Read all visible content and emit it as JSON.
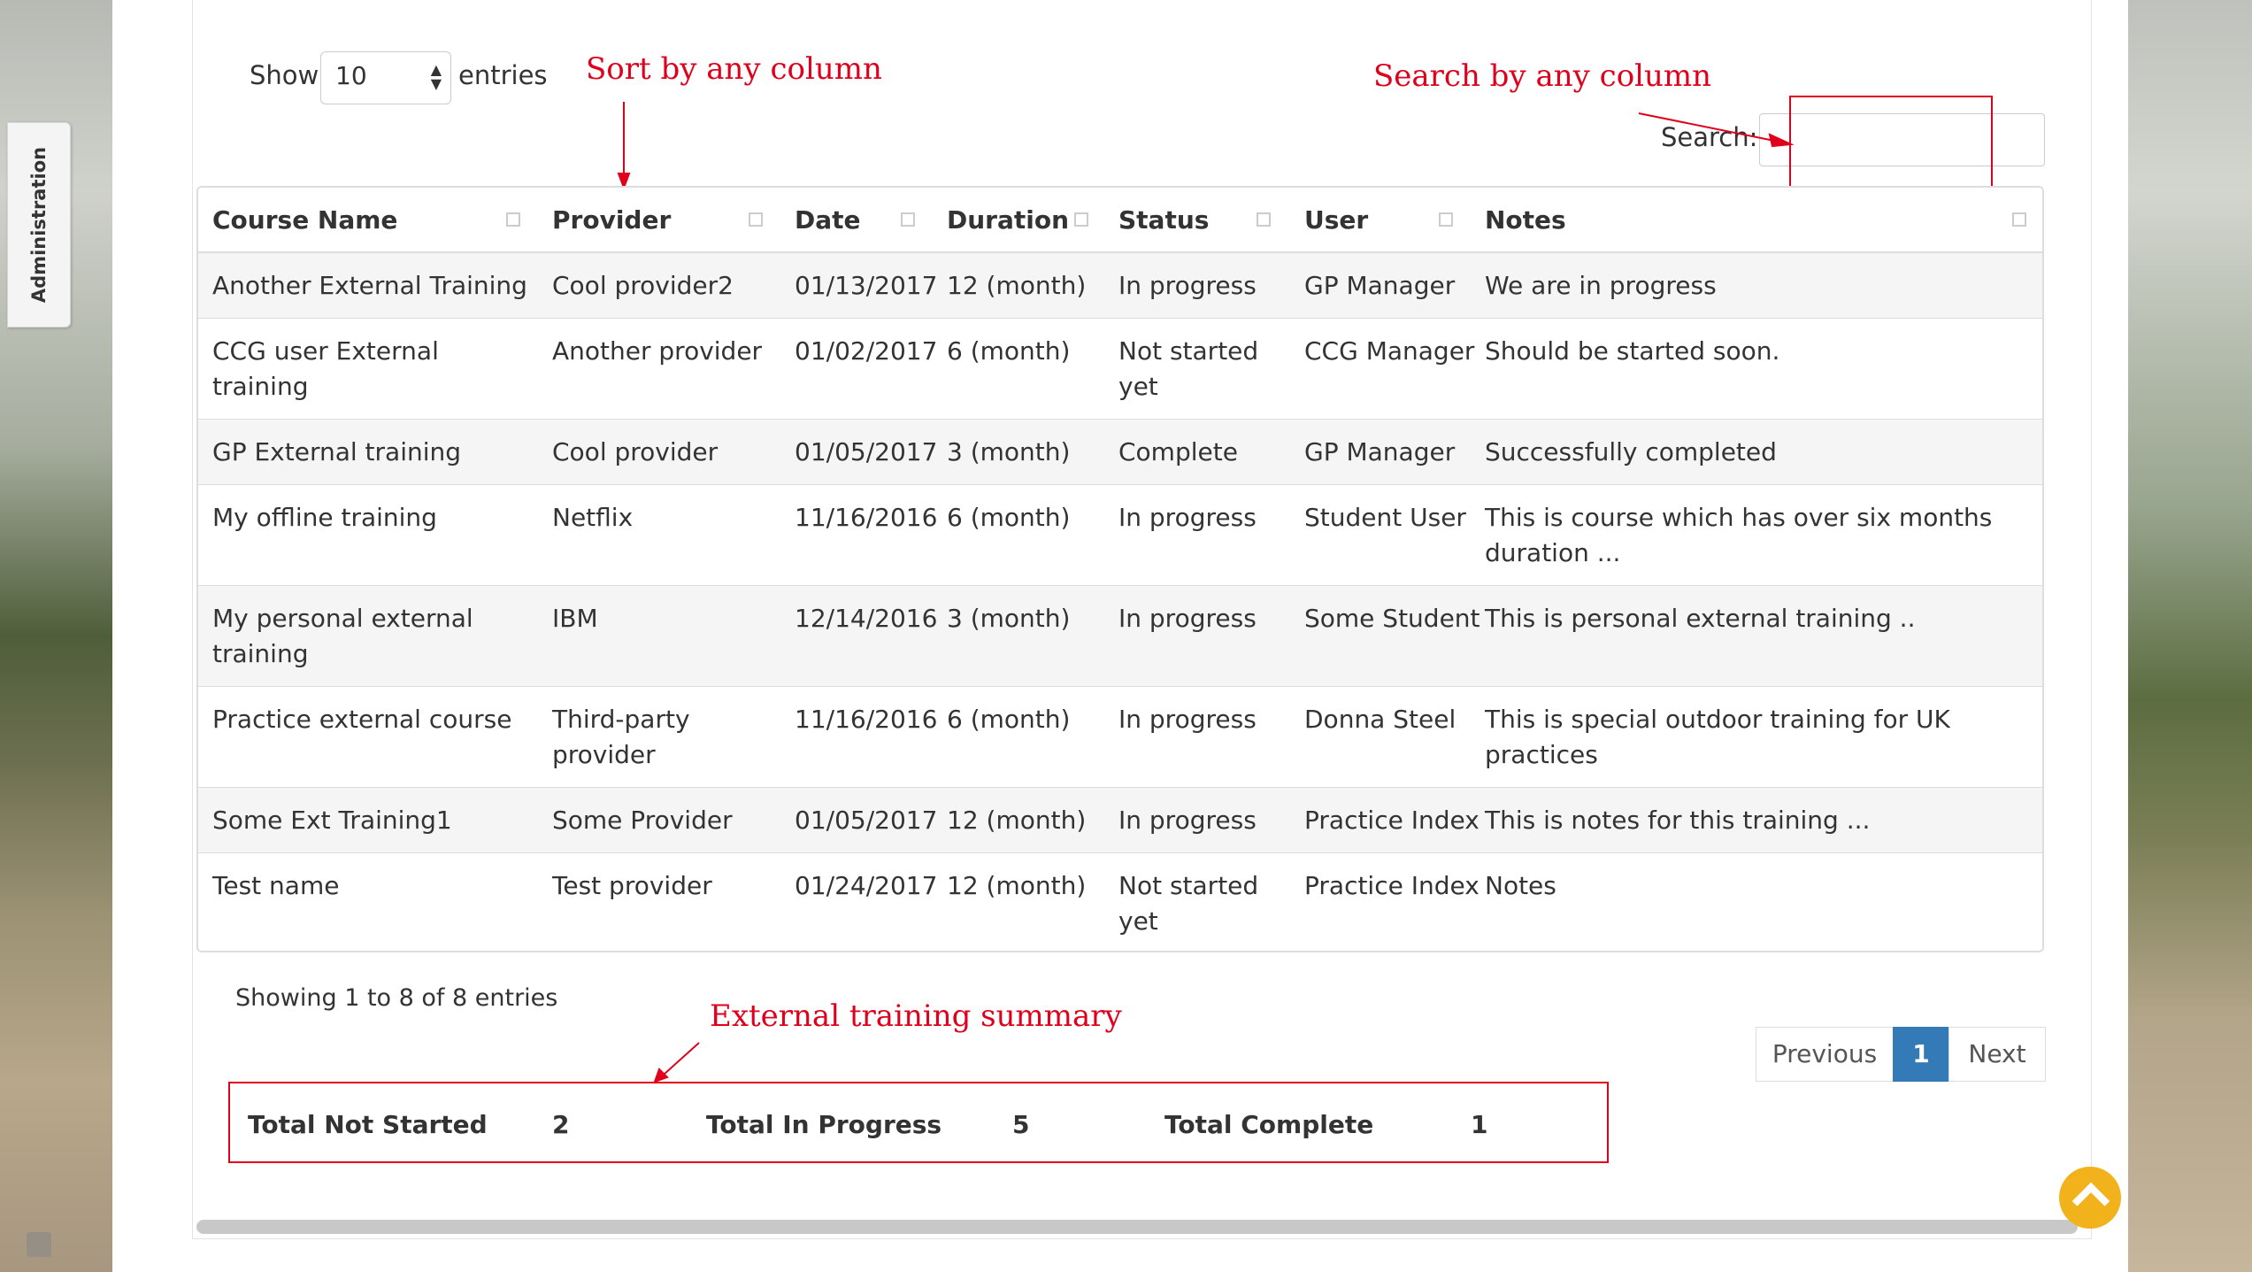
{
  "sidebar": {
    "admin_tab": "Administration"
  },
  "length_menu": {
    "show_label": "Show",
    "value": "10",
    "entries_label": "entries"
  },
  "search": {
    "label": "Search:",
    "value": ""
  },
  "annotations": {
    "sort": "Sort by any column",
    "search": "Search by any column",
    "summary": "External training summary"
  },
  "table": {
    "headers": [
      "Course Name",
      "Provider",
      "Date",
      "Duration",
      "Status",
      "User",
      "Notes"
    ],
    "rows": [
      [
        "Another External Training",
        "Cool provider2",
        "01/13/2017",
        "12  (month)",
        "In progress",
        "GP Manager",
        "We are in progress"
      ],
      [
        "CCG user External training",
        "Another provider",
        "01/02/2017",
        "6  (month)",
        "Not started yet",
        "CCG Manager",
        "Should be started soon."
      ],
      [
        "GP External training",
        "Cool provider",
        "01/05/2017",
        "3  (month)",
        "Complete",
        "GP Manager",
        "Successfully completed"
      ],
      [
        "My offline training",
        "Netflix",
        "11/16/2016",
        "6  (month)",
        "In progress",
        "Student User",
        "This is course which has over six months duration ..."
      ],
      [
        "My personal external training",
        "IBM",
        "12/14/2016",
        "3  (month)",
        "In progress",
        "Some Student",
        "This is personal external training .."
      ],
      [
        "Practice external course",
        "Third-party provider",
        "11/16/2016",
        "6  (month)",
        "In progress",
        "Donna Steel",
        "This is special outdoor training for UK practices"
      ],
      [
        "Some Ext Training1",
        "Some Provider",
        "01/05/2017",
        "12  (month)",
        "In progress",
        "Practice Index",
        "This is notes for this training ..."
      ],
      [
        "Test name",
        "Test provider",
        "01/24/2017",
        "12  (month)",
        "Not started yet",
        "Practice Index",
        "Notes"
      ]
    ]
  },
  "info": "Showing 1 to 8 of 8 entries",
  "pagination": {
    "previous": "Previous",
    "current": "1",
    "next": "Next"
  },
  "summary": {
    "not_started_label": "Total Not Started",
    "not_started_value": "2",
    "in_progress_label": "Total In Progress",
    "in_progress_value": "5",
    "complete_label": "Total Complete",
    "complete_value": "1"
  }
}
